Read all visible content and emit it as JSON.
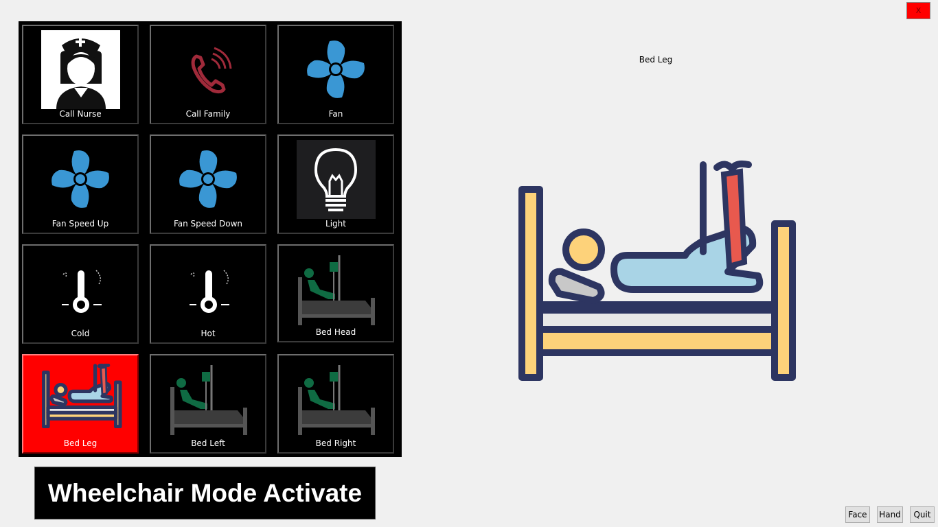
{
  "window": {
    "close_label": "X"
  },
  "tiles": [
    {
      "label": "Call Nurse",
      "icon": "nurse-icon"
    },
    {
      "label": "Call Family",
      "icon": "phone-icon"
    },
    {
      "label": "Fan",
      "icon": "fan-icon"
    },
    {
      "label": "Fan Speed Up",
      "icon": "fan-icon"
    },
    {
      "label": "Fan Speed Down",
      "icon": "fan-icon"
    },
    {
      "label": "Light",
      "icon": "lightbulb-icon"
    },
    {
      "label": "Cold",
      "icon": "thermometer-icon"
    },
    {
      "label": "Hot",
      "icon": "thermometer-icon"
    },
    {
      "label": "Bed Head",
      "icon": "hospital-bed-icon"
    },
    {
      "label": "Bed Leg",
      "icon": "bed-leg-icon",
      "selected": true
    },
    {
      "label": "Bed Left",
      "icon": "hospital-bed-icon"
    },
    {
      "label": "Bed Right",
      "icon": "hospital-bed-icon"
    }
  ],
  "banner": {
    "text": "Wheelchair Mode Activate"
  },
  "preview": {
    "label": "Bed Leg",
    "icon": "bed-leg-icon"
  },
  "buttons": {
    "face": "Face",
    "hand": "Hand",
    "quit": "Quit"
  },
  "colors": {
    "selected": "#ff0000",
    "fan_blue": "#3a97d4",
    "bed_navy": "#2d3561",
    "bed_yellow": "#fdd27a"
  }
}
